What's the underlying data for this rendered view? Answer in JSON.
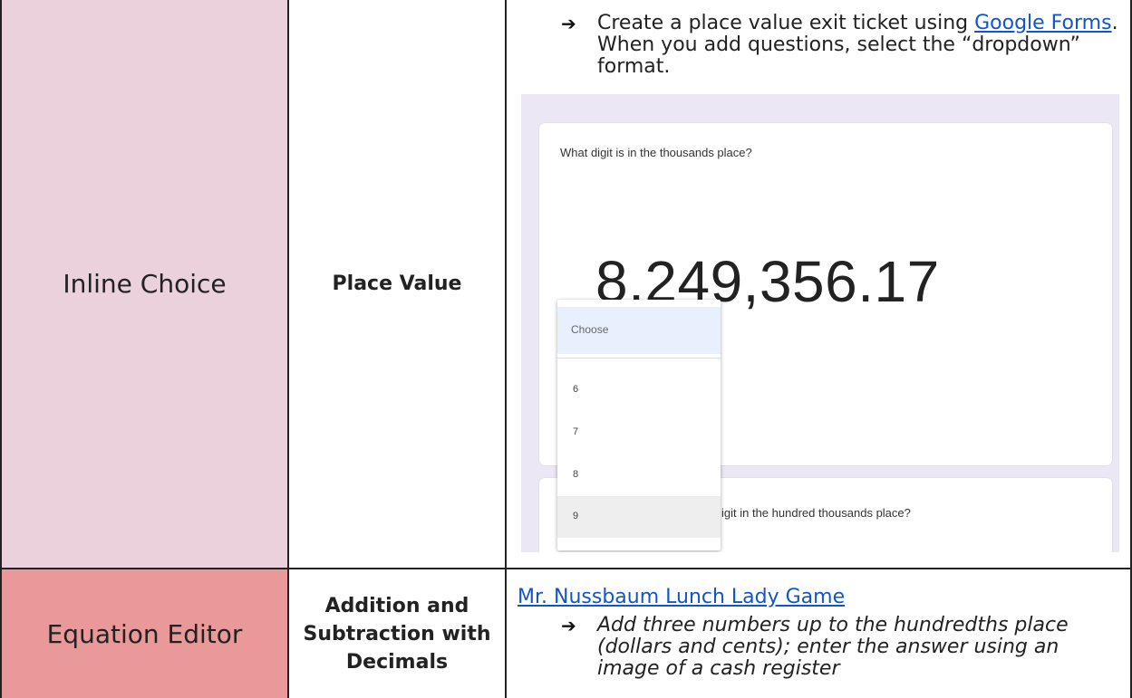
{
  "rows": [
    {
      "type": "Inline Choice",
      "topic": "Place Value",
      "bullet_prefix": "Create a place value exit ticket using ",
      "bullet_link": "Google Forms",
      "bullet_suffix": ". When you add questions, select the “dropdown” format.",
      "form": {
        "question1": "What digit is in the thousands place?",
        "number": "8,249,356.17",
        "dropdown_placeholder": "Choose",
        "options": [
          "6",
          "7",
          "8",
          "9"
        ],
        "highlighted_option": "9",
        "question2_partial": "igit in the hundred thousands place?"
      }
    },
    {
      "type": "Equation Editor",
      "topic": "Addition and Subtraction with Decimals",
      "topic_lines": [
        "Addition and",
        "Subtraction with",
        "Decimals"
      ],
      "link": "Mr. Nussbaum Lunch Lady Game",
      "bullet": "Add three numbers up to the hundredths place (dollars and cents); enter the answer using an image of a cash register"
    }
  ],
  "arrow_glyph": "➔",
  "colors": {
    "inline_choice_bg": "#ead1dc",
    "equation_editor_bg": "#e9999a",
    "link": "#1155cc"
  }
}
